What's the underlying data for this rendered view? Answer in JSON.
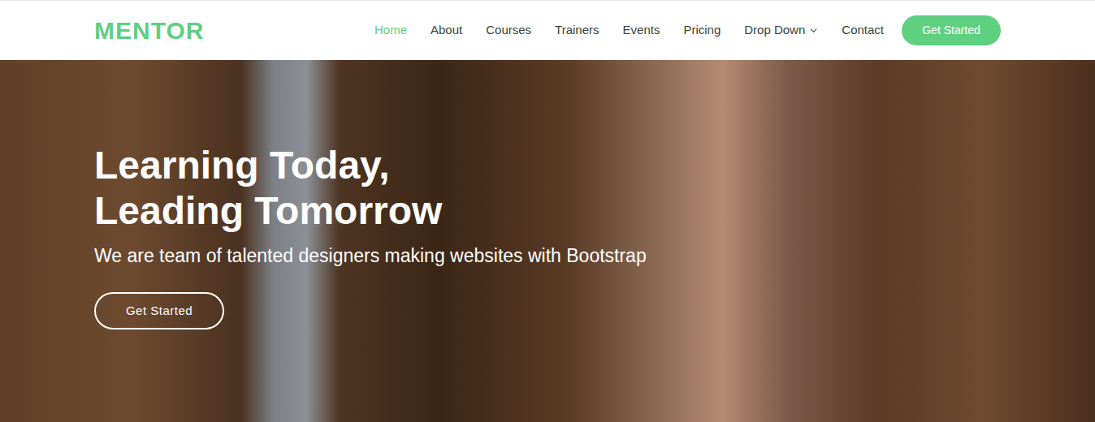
{
  "header": {
    "logo": "MENTOR",
    "nav": [
      {
        "label": "Home",
        "selected": true,
        "kind": "link"
      },
      {
        "label": "About",
        "selected": false,
        "kind": "link"
      },
      {
        "label": "Courses",
        "selected": false,
        "kind": "link"
      },
      {
        "label": "Trainers",
        "selected": false,
        "kind": "link"
      },
      {
        "label": "Events",
        "selected": false,
        "kind": "link"
      },
      {
        "label": "Pricing",
        "selected": false,
        "kind": "link"
      },
      {
        "label": "Drop Down",
        "selected": false,
        "kind": "dropdown"
      },
      {
        "label": "Contact",
        "selected": false,
        "kind": "link"
      }
    ],
    "cta": "Get Started"
  },
  "hero": {
    "title_lines": [
      "Learning Today,",
      "Leading Tomorrow"
    ],
    "subtitle": "We are team of talented designers making websites with Bootstrap",
    "button": "Get Started"
  }
}
